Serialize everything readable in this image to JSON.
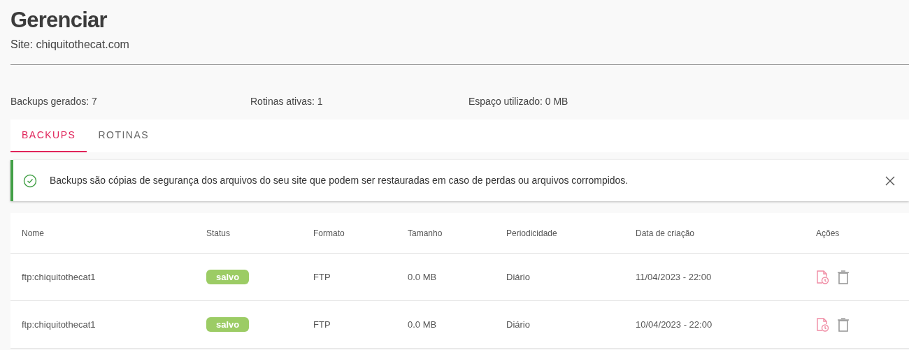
{
  "title": "Gerenciar",
  "subtitle": "Site: chiquitothecat.com",
  "stats": [
    "Backups gerados: 7",
    "Rotinas ativas: 1",
    "Espaço utilizado: 0 MB"
  ],
  "tabs": [
    {
      "label": "BACKUPS",
      "selected": true
    },
    {
      "label": "ROTINAS",
      "selected": false
    }
  ],
  "alert": {
    "text": "Backups são cópias de segurança dos arquivos do seu site que podem ser restauradas em caso de perdas ou arquivos corrompidos."
  },
  "table": {
    "columns": [
      "Nome",
      "Status",
      "Formato",
      "Tamanho",
      "Periodicidade",
      "Data de criação",
      "Ações"
    ],
    "rows": [
      {
        "name": "ftp:chiquitothecat1",
        "status": "salvo",
        "format": "FTP",
        "size": "0.0 MB",
        "period": "Diário",
        "created": "11/04/2023 - 22:00"
      },
      {
        "name": "ftp:chiquitothecat1",
        "status": "salvo",
        "format": "FTP",
        "size": "0.0 MB",
        "period": "Diário",
        "created": "10/04/2023 - 22:00"
      }
    ]
  }
}
